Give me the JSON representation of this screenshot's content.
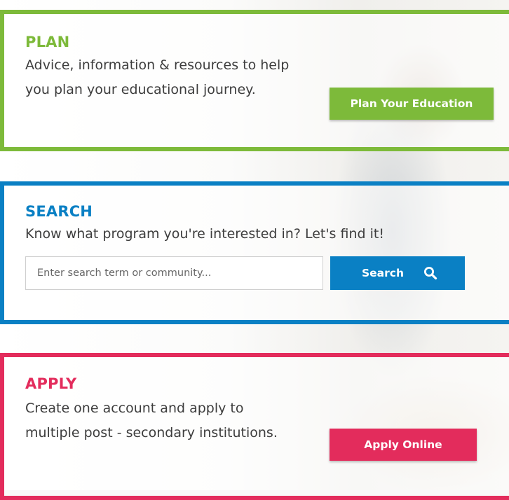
{
  "plan": {
    "heading": "PLAN",
    "description": "Advice, information & resources to help you plan your educational journey.",
    "button_label": "Plan Your Education"
  },
  "search": {
    "heading": "SEARCH",
    "description": "Know what program you're interested in? Let's find it!",
    "placeholder": "Enter search term or community...",
    "button_label": "Search",
    "button_icon": "search-icon"
  },
  "apply": {
    "heading": "APPLY",
    "description": "Create one account and apply to multiple post - secondary institutions.",
    "button_label": "Apply Online"
  },
  "colors": {
    "plan_green": "#7dba3a",
    "search_blue": "#0a80c4",
    "apply_pink": "#e32c5c"
  }
}
